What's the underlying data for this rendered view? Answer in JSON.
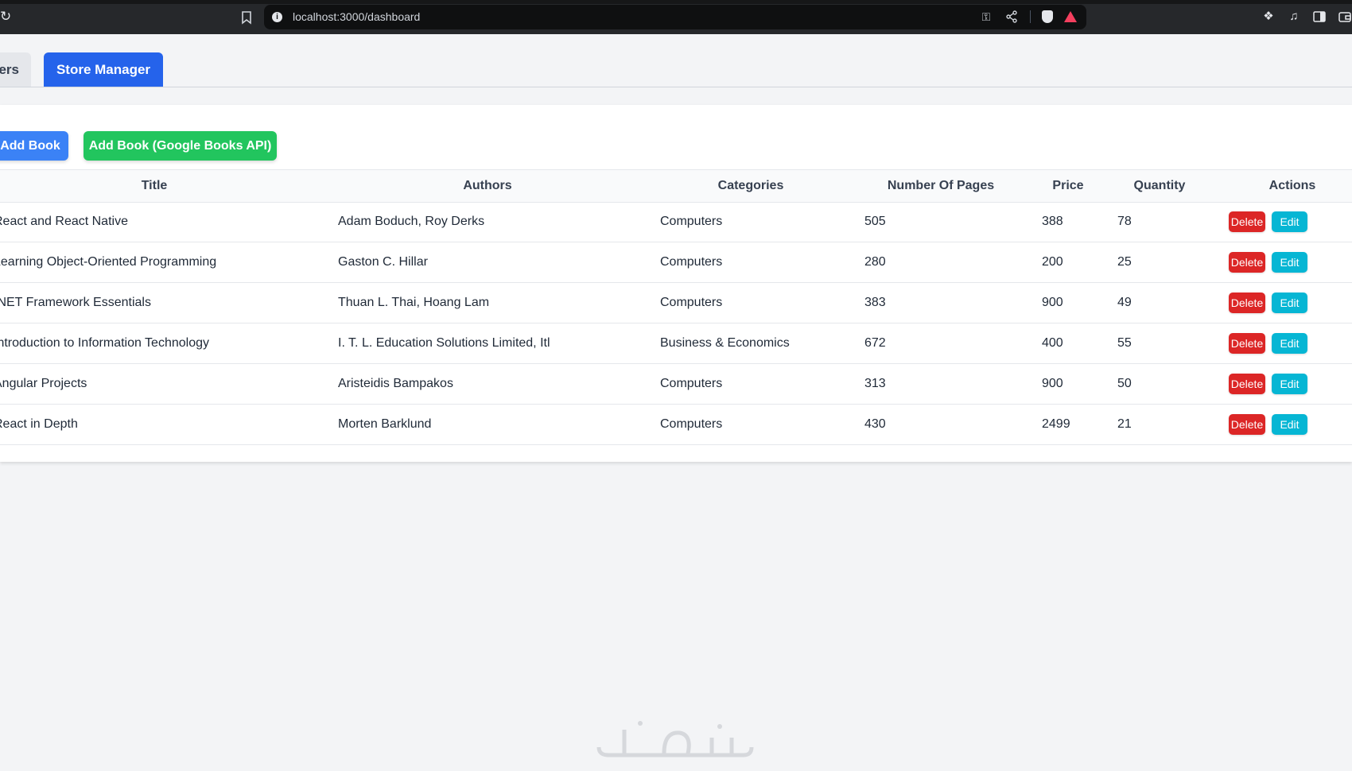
{
  "browser": {
    "url": "localhost:3000/dashboard"
  },
  "tabs": [
    {
      "label": "ers"
    },
    {
      "label": "Store Manager"
    }
  ],
  "toolbar": {
    "add_book_label": "Add Book",
    "add_google_label": "Add Book (Google Books API)"
  },
  "table": {
    "headers": {
      "title": "Title",
      "authors": "Authors",
      "categories": "Categories",
      "pages": "Number Of Pages",
      "price": "Price",
      "quantity": "Quantity",
      "actions": "Actions"
    },
    "rows": [
      {
        "title": "React and React Native",
        "authors": "Adam Boduch, Roy Derks",
        "categories": "Computers",
        "pages": "505",
        "price": "388",
        "quantity": "78"
      },
      {
        "title": "Learning Object-Oriented Programming",
        "authors": "Gaston C. Hillar",
        "categories": "Computers",
        "pages": "280",
        "price": "200",
        "quantity": "25"
      },
      {
        "title": ".NET Framework Essentials",
        "authors": "Thuan L. Thai, Hoang Lam",
        "categories": "Computers",
        "pages": "383",
        "price": "900",
        "quantity": "49"
      },
      {
        "title": "Introduction to Information Technology",
        "authors": "I. T. L. Education Solutions Limited, Itl",
        "categories": "Business & Economics",
        "pages": "672",
        "price": "400",
        "quantity": "55"
      },
      {
        "title": "Angular Projects",
        "authors": "Aristeidis Bampakos",
        "categories": "Computers",
        "pages": "313",
        "price": "900",
        "quantity": "50"
      },
      {
        "title": "React in Depth",
        "authors": "Morten Barklund",
        "categories": "Computers",
        "pages": "430",
        "price": "2499",
        "quantity": "21"
      }
    ],
    "delete_label": "Delete",
    "edit_label": "Edit"
  },
  "colors": {
    "tab_active": "#2563eb",
    "add_button": "#3b82f6",
    "google_button": "#22c55e",
    "delete_button": "#dc2626",
    "edit_button": "#06b6d4"
  },
  "icons": [
    "reload-icon",
    "bookmark-icon",
    "info-icon",
    "key-icon",
    "share-icon",
    "brave-shield-icon",
    "brave-rewards-icon",
    "extensions-icon",
    "media-icon",
    "sidebar-icon",
    "wallet-icon"
  ]
}
